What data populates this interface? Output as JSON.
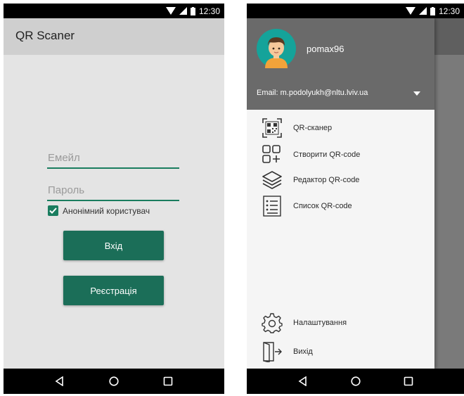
{
  "status": {
    "time": "12:30"
  },
  "left": {
    "app_title": "QR Scaner",
    "email_placeholder": "Емейл",
    "password_placeholder": "Пароль",
    "anonymous_label": "Анонімний користувач",
    "anonymous_checked": true,
    "login_label": "Вхід",
    "register_label": "Реєстрація"
  },
  "drawer": {
    "username": "pomax96",
    "email": "Email: m.podolyukh@nltu.lviv.ua",
    "items": [
      {
        "label": "QR-сканер",
        "icon": "qr-code-icon"
      },
      {
        "label": "Створити QR-code",
        "icon": "create-grid-icon"
      },
      {
        "label": "Редактор QR-code",
        "icon": "layers-icon"
      },
      {
        "label": "Список QR-code",
        "icon": "list-icon"
      }
    ],
    "bottom_items": [
      {
        "label": "Налаштування",
        "icon": "gear-icon"
      },
      {
        "label": "Вихід",
        "icon": "exit-door-icon"
      }
    ]
  },
  "colors": {
    "accent": "#1b6e58",
    "app_bar": "#cfcfcf",
    "drawer_header": "#6a6a6a",
    "avatar_bg": "#15a39a"
  }
}
